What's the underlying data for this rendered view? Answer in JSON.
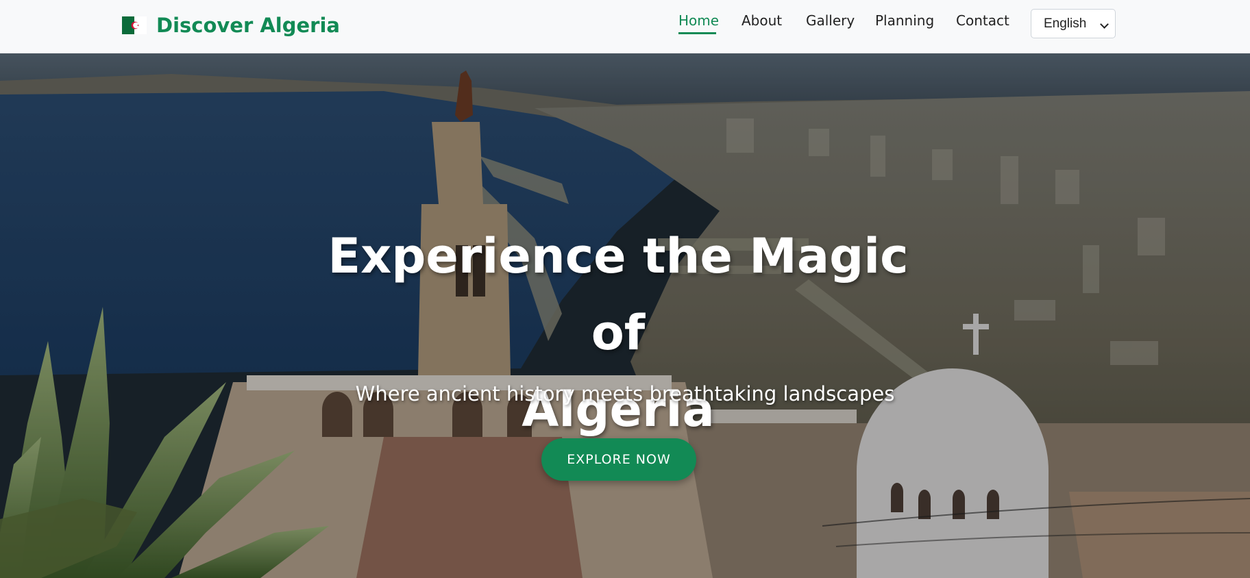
{
  "brand": {
    "name": "Discover Algeria",
    "flag_icon": "algeria-flag-icon"
  },
  "nav": {
    "items": [
      {
        "label": "Home",
        "active": true
      },
      {
        "label": "About",
        "active": false
      },
      {
        "label": "Gallery",
        "active": false
      },
      {
        "label": "Planning",
        "active": false
      },
      {
        "label": "Contact",
        "active": false
      }
    ],
    "language": {
      "selected": "English",
      "icon": "chevron-down-icon"
    }
  },
  "hero": {
    "title_line1": "Experience the Magic of",
    "title_line2": "Algeria",
    "subtitle": "Where ancient history meets breathtaking landscapes",
    "cta_label": "EXPLORE NOW"
  },
  "colors": {
    "accent": "#128a55",
    "nav_bg": "#f8f9fa",
    "nav_text": "#222222"
  }
}
